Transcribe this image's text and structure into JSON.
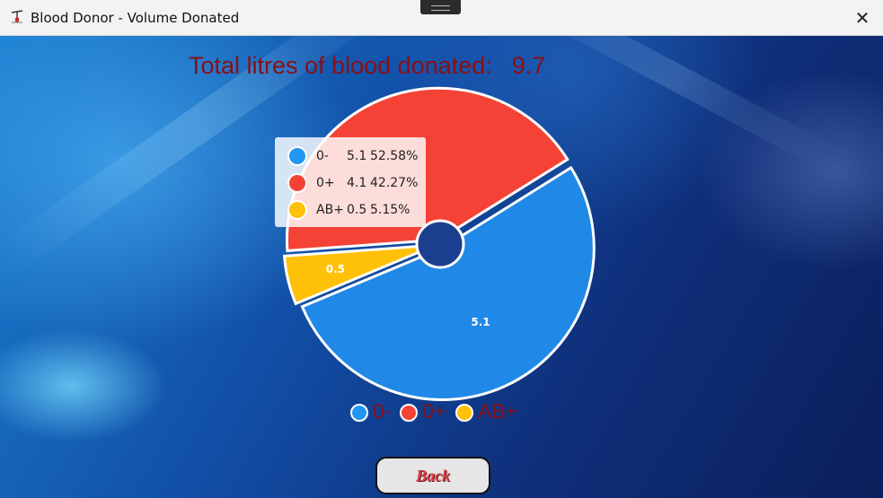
{
  "window": {
    "title": "Blood Donor - Volume Donated",
    "close_glyph": "✕"
  },
  "header": {
    "total_label": "Total litres of blood donated:",
    "total_value": "9.7"
  },
  "tooltip": {
    "rows": [
      {
        "category": "0-",
        "value": "5.1",
        "percent": "52.58%",
        "color": "#2196f3"
      },
      {
        "category": "0+",
        "value": "4.1",
        "percent": "42.27%",
        "color": "#f44336"
      },
      {
        "category": "AB+",
        "value": "0.5",
        "percent": "5.15%",
        "color": "#ffc107"
      }
    ]
  },
  "chart_data": {
    "type": "pie",
    "title": "",
    "categories": [
      "0-",
      "0+",
      "AB+"
    ],
    "values": [
      5.1,
      4.1,
      0.5
    ],
    "percentages": [
      52.58,
      42.27,
      5.15
    ],
    "colors": [
      "#2088e6",
      "#f44336",
      "#ffc107"
    ],
    "slice_labels": [
      "5.1",
      "",
      "0.5"
    ],
    "legend_position": "bottom",
    "donut_center": true,
    "exploded": true
  },
  "legend": {
    "items": [
      {
        "label": "0-",
        "color": "#2196f3"
      },
      {
        "label": "0+",
        "color": "#f44336"
      },
      {
        "label": "AB+",
        "color": "#ffc107"
      }
    ]
  },
  "actions": {
    "back_label": "Back"
  },
  "icons": {
    "app": "blood-drop-icon",
    "close": "close-icon",
    "drag": "drag-handle-icon"
  }
}
